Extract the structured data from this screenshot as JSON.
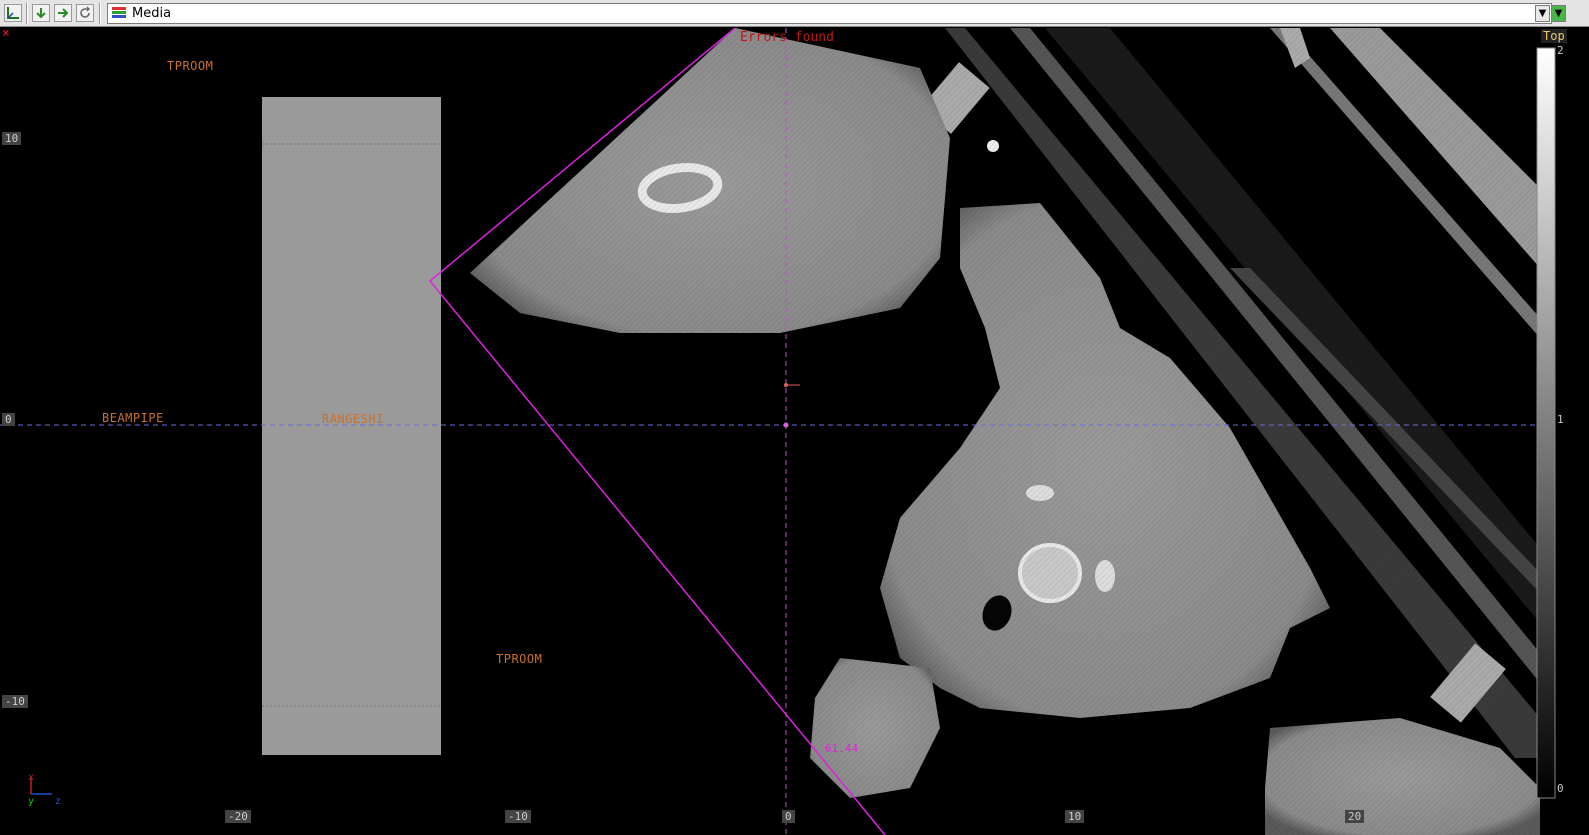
{
  "toolbar": {
    "media_label": "Media",
    "icons": [
      "axes-icon",
      "arrow-down-icon",
      "arrow-right-icon",
      "refresh-icon",
      "media-stack-icon"
    ]
  },
  "viewer": {
    "error_text": "Errors found",
    "orientation_label": "Top",
    "structures": {
      "tproom_top": "TPROOM",
      "tproom_bottom": "TPROOM",
      "beampipe": "BEAMPIPE",
      "rangeshi": "RANGESHI"
    },
    "axis_ticks_x": [
      "-20",
      "-10",
      "0",
      "10",
      "20"
    ],
    "axis_ticks_y": [
      "10",
      "0",
      "-10"
    ],
    "colorbar_ticks": [
      "2",
      "1",
      "0"
    ],
    "beam_label": "61.44",
    "orientation_axes": {
      "x": "x",
      "y": "y",
      "z": "z"
    },
    "close_mark": "×"
  },
  "colors": {
    "magenta": "#e020e0",
    "structure_label": "#c8702e",
    "error": "#c01818",
    "crosshair": "#6a6ae0"
  }
}
